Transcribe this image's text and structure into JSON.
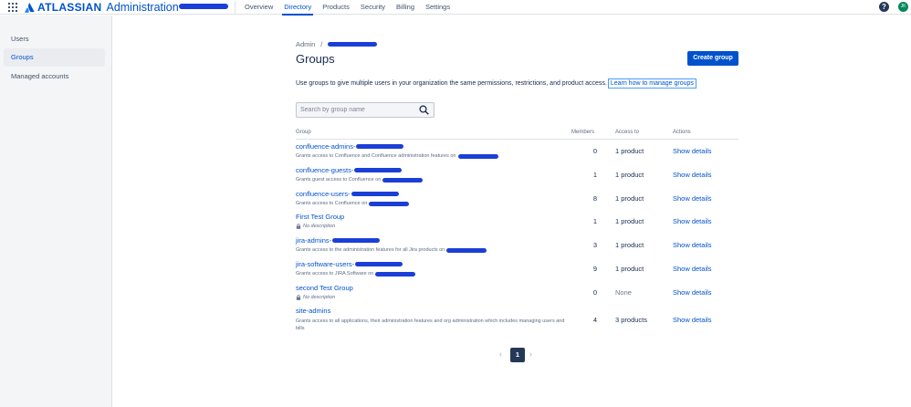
{
  "header": {
    "brand": "ATLASSIAN",
    "product": "Administration",
    "nav": [
      "Overview",
      "Directory",
      "Products",
      "Security",
      "Billing",
      "Settings"
    ],
    "active_nav": "Directory",
    "help_glyph": "?",
    "avatar_initials": "JK",
    "accent_color": "#0052cc"
  },
  "sidebar": {
    "items": [
      "Users",
      "Groups",
      "Managed accounts"
    ],
    "active": "Groups"
  },
  "page": {
    "breadcrumb_root": "Admin",
    "breadcrumb_sep": "/",
    "title": "Groups",
    "create_button": "Create group",
    "intro": "Use groups to give multiple users in your organization the same permissions, restrictions, and product access.",
    "learn_link": "Learn how to manage groups",
    "search_placeholder": "Search by group name"
  },
  "table": {
    "headers": {
      "group": "Group",
      "members": "Members",
      "access": "Access to",
      "actions": "Actions"
    },
    "rows": [
      {
        "name": "confluence-admins-",
        "description": "Grants access to Confluence and Confluence administration features on",
        "members": "0",
        "access": "1 product",
        "action": "Show details"
      },
      {
        "name": "confluence-guests-",
        "description": "Grants guest access to Confluence on",
        "members": "1",
        "access": "1 product",
        "action": "Show details"
      },
      {
        "name": "confluence-users-",
        "description": "Grants access to Confluence on",
        "members": "8",
        "access": "1 product",
        "action": "Show details"
      },
      {
        "name": "First Test Group",
        "description": "No description",
        "members": "1",
        "access": "1 product",
        "action": "Show details"
      },
      {
        "name": "jira-admins-",
        "description": "Grants access to the administration features for all Jira products on",
        "members": "3",
        "access": "1 product",
        "action": "Show details"
      },
      {
        "name": "jira-software-users-",
        "description": "Grants access to JIRA Software on",
        "members": "9",
        "access": "1 product",
        "action": "Show details"
      },
      {
        "name": "second Test Group",
        "description": "No description",
        "members": "0",
        "access": "None",
        "action": "Show details"
      },
      {
        "name": "site-admins",
        "description": "Grants access to all applications, their administration features and org administration which includes managing users and bills",
        "members": "4",
        "access": "3 products",
        "action": "Show details"
      }
    ]
  },
  "pagination": {
    "current": "1",
    "prev_glyph": "‹",
    "next_glyph": "›"
  }
}
